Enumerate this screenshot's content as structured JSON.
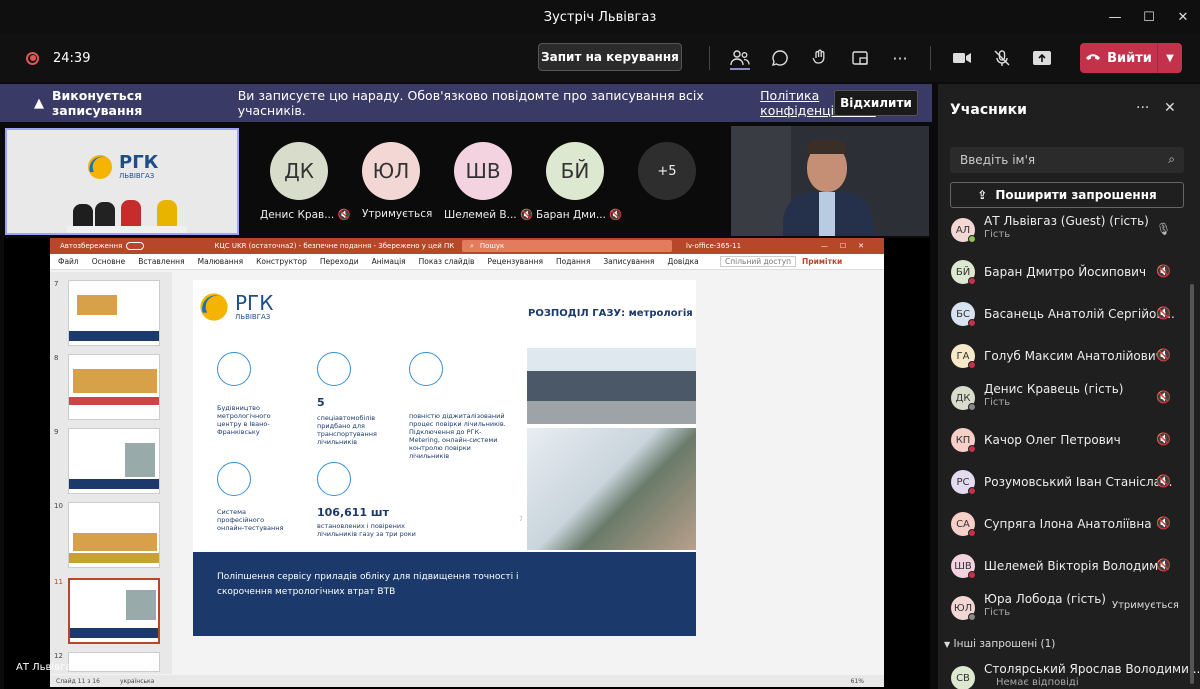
{
  "window": {
    "title": "Зустріч Львівгаз",
    "min": "—",
    "max": "☐",
    "close": "✕"
  },
  "toolbar": {
    "timer": "24:39",
    "control_label": "Запит на керування",
    "leave_label": "Вийти",
    "leave_dropdown": "⌄",
    "icons": {
      "people": "people-icon",
      "chat": "chat-icon",
      "react": "react-icon",
      "rooms": "rooms-icon",
      "more": "more-icon",
      "camera": "camera-icon",
      "mic": "mic-off-icon",
      "share": "share-icon",
      "phone": "phone-icon"
    }
  },
  "banner": {
    "title": "Виконується записування",
    "message": "Ви записуєте цю нараду. Обов'язково повідомте про записування всіх учасників.",
    "link": "Політика конфіденційності",
    "dismiss": "Відхилити"
  },
  "gallery": {
    "tiles": [
      {
        "initials": "ДК",
        "name": "Денис Крав...",
        "color": "#d7dccb",
        "muted": true
      },
      {
        "initials": "ЮЛ",
        "name": "Утримується",
        "color": "#f2d7d5",
        "muted": false
      },
      {
        "initials": "ШВ",
        "name": "Шелемей В...",
        "color": "#f3d3df",
        "muted": true
      },
      {
        "initials": "БЙ",
        "name": "Баран Дми...",
        "color": "#dde8d0",
        "muted": true
      }
    ],
    "overflow": "+5",
    "logo_text": "РГК",
    "logo_sub": "ЛЬВІВГАЗ"
  },
  "ppt": {
    "autosave": "Автозбереження",
    "filename": "КЦС UKR (остаточна2) - безпечне подання - Збережено у цей ПК",
    "search": "Пошук",
    "account": "lv-office-365-11",
    "menu": [
      "Файл",
      "Основне",
      "Вставлення",
      "Малювання",
      "Конструктор",
      "Переходи",
      "Анімація",
      "Показ слайдів",
      "Рецензування",
      "Подання",
      "Записування",
      "Довідка"
    ],
    "share": "Спільний доступ",
    "notes": "Примітки",
    "thumb_numbers": [
      "7",
      "8",
      "9",
      "10",
      "11",
      "12"
    ],
    "status": [
      "Слайд 11 з 16",
      "українська"
    ],
    "zoom": "61%"
  },
  "slide": {
    "logo": "РГК",
    "logo_sub": "ЛЬВІВГАЗ",
    "title": "РОЗПОДІЛ ГАЗУ: метрологія",
    "items": [
      {
        "text": "Будівництво метрологічного центру в Івано-Франківську"
      },
      {
        "num": "5",
        "text": "спеціавтомобілів придбано для транспортування лічильників"
      },
      {
        "text": "повністю діджиталізований процес повірки лічильників. Підключення до РГК-Metering, онлайн-системи контролю повірки лічильників"
      },
      {
        "text": "Система професійного онлайн-тестування"
      },
      {
        "num": "106,611 шт",
        "text": "встановлених і повірених лічильників газу за три роки"
      }
    ],
    "footer": "Поліпшення сервісу приладів обліку для підвищення точності і скорочення метрологічних втрат ВТВ",
    "page": "7"
  },
  "presenter_label": "АТ Львівгаз (Guest) (гість)",
  "sidebar": {
    "title": "Учасники",
    "more": "···",
    "close": "✕",
    "search_placeholder": "Введіть ім'я",
    "share_label": "Поширити запрошення",
    "participants": [
      {
        "initials": "АЛ",
        "name": "АТ Львівгаз (Guest) (гість)",
        "sub": "Гість",
        "color": "#f2d7d5",
        "mic": "🎤"
      },
      {
        "initials": "БЙ",
        "name": "Баран Дмитро Йосипович",
        "sub": "",
        "color": "#dde8d0",
        "mic": "🔇"
      },
      {
        "initials": "БС",
        "name": "Басанець Анатолій Сергійов...",
        "sub": "",
        "color": "#d8e3f0",
        "mic": "🔇"
      },
      {
        "initials": "ГА",
        "name": "Голуб Максим Анатолійович",
        "sub": "",
        "color": "#f5e9c9",
        "mic": "🔇"
      },
      {
        "initials": "ДК",
        "name": "Денис Кравець (гість)",
        "sub": "Гість",
        "color": "#d7dccb",
        "mic": "🔇"
      },
      {
        "initials": "КП",
        "name": "Качор Олег Петрович",
        "sub": "",
        "color": "#f6cfc8",
        "mic": "🔇"
      },
      {
        "initials": "РС",
        "name": "Розумовський Іван Станісла...",
        "sub": "",
        "color": "#e3dcf0",
        "mic": "🔇"
      },
      {
        "initials": "СА",
        "name": "Супряга Ілона Анатоліївна",
        "sub": "",
        "color": "#f6cfc8",
        "mic": "🔇"
      },
      {
        "initials": "ШВ",
        "name": "Шелемей Вікторія Володим...",
        "sub": "",
        "color": "#f3d3df",
        "mic": "🔇"
      },
      {
        "initials": "ЮЛ",
        "name": "Юра Лобода (гість)",
        "sub": "Гість",
        "color": "#f2d7d5",
        "mic": "Утримується"
      }
    ],
    "other_section": "Інші запрошені (1)",
    "invited": {
      "initials": "СВ",
      "name": "Столярський Ярослав Володими...",
      "sub": "Немає відповіді",
      "color": "#dde8d0"
    }
  }
}
